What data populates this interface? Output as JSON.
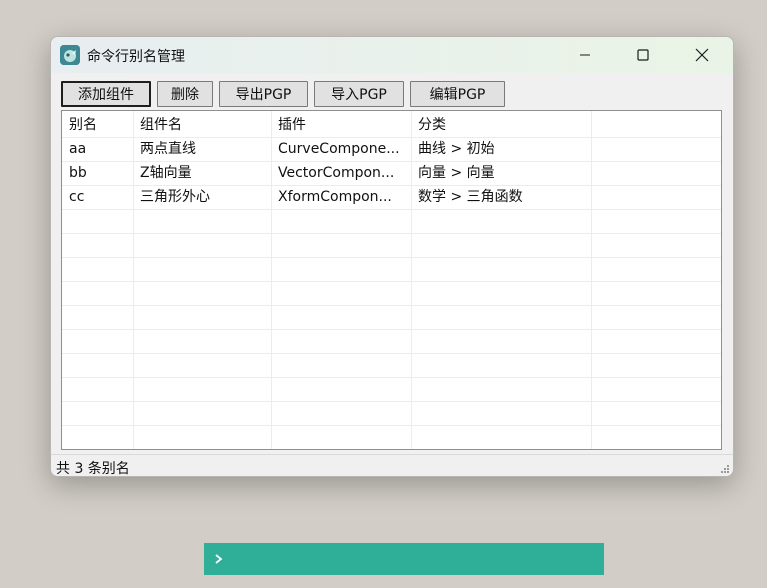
{
  "window": {
    "title": "命令行别名管理"
  },
  "toolbar": {
    "buttons": [
      {
        "label": "添加组件"
      },
      {
        "label": "删除"
      },
      {
        "label": "导出PGP"
      },
      {
        "label": "导入PGP"
      },
      {
        "label": "编辑PGP"
      }
    ]
  },
  "table": {
    "headers": [
      "别名",
      "组件名",
      "插件",
      "分类"
    ],
    "rows": [
      [
        "aa",
        "两点直线",
        "CurveCompone...",
        "曲线 > 初始"
      ],
      [
        "bb",
        "Z轴向量",
        "VectorCompon...",
        "向量 > 向量"
      ],
      [
        "cc",
        "三角形外心",
        "XformCompon...",
        "数学 > 三角函数"
      ]
    ]
  },
  "status": {
    "text": "共 3 条别名"
  },
  "colors": {
    "accent_console": "#2fae98",
    "window_bg": "#f0f0f0",
    "desktop": "#d2cdc6"
  },
  "icons": {
    "app": "app-logo-icon",
    "minimize": "minimize-icon",
    "maximize": "maximize-icon",
    "close": "close-icon",
    "console": "chevron-right-icon"
  }
}
